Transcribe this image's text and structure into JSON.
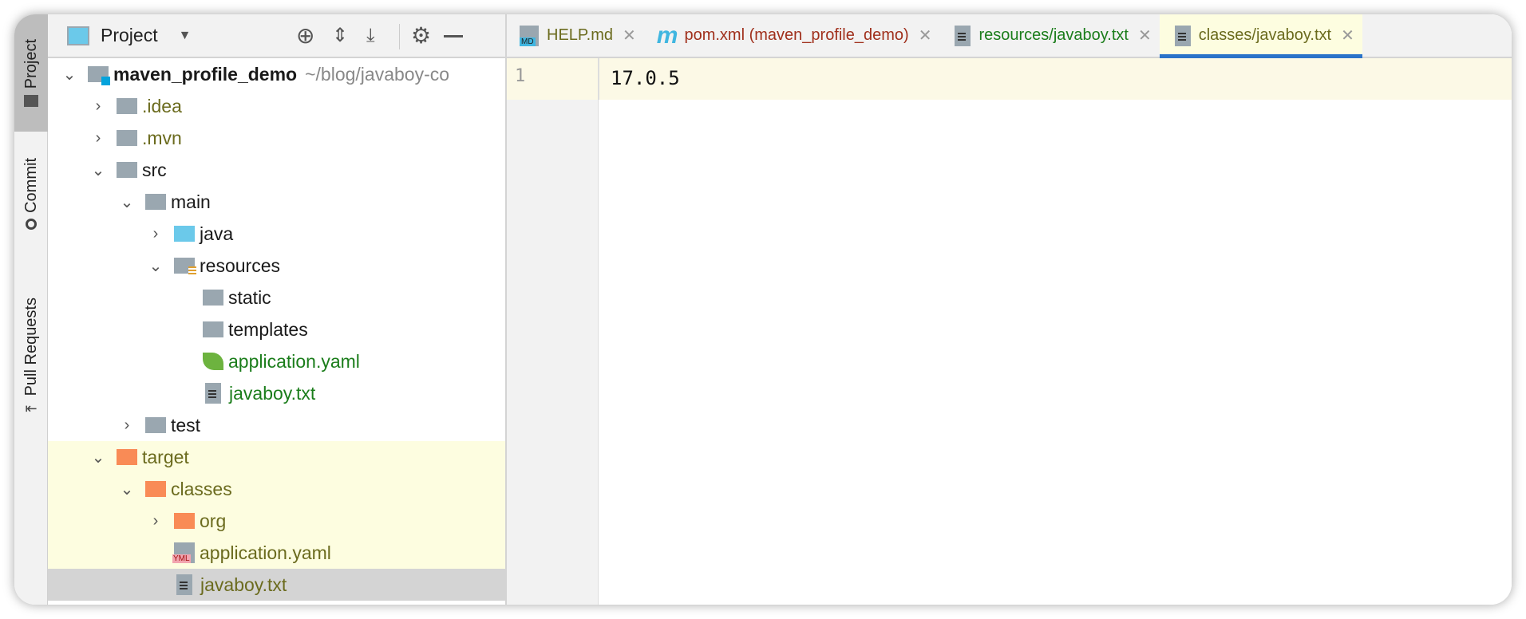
{
  "side_tabs": [
    "Project",
    "Commit",
    "Pull Requests"
  ],
  "panel": {
    "title": "Project"
  },
  "tree": [
    {
      "label": "maven_profile_demo",
      "suffix": "~/blog/javaboy-co",
      "level": 0,
      "chev": "v",
      "type": "module"
    },
    {
      "label": ".idea",
      "level": 1,
      "chev": ">",
      "type": "folder",
      "color": "#6b6b1e"
    },
    {
      "label": ".mvn",
      "level": 1,
      "chev": ">",
      "type": "folder",
      "color": "#6b6b1e"
    },
    {
      "label": "src",
      "level": 1,
      "chev": "v",
      "type": "folder"
    },
    {
      "label": "main",
      "level": 2,
      "chev": "v",
      "type": "folder"
    },
    {
      "label": "java",
      "level": 3,
      "chev": ">",
      "type": "folder-blue"
    },
    {
      "label": "resources",
      "level": 3,
      "chev": "v",
      "type": "folder-res"
    },
    {
      "label": "static",
      "level": 4,
      "type": "folder"
    },
    {
      "label": "templates",
      "level": 4,
      "type": "folder"
    },
    {
      "label": "application.yaml",
      "level": 4,
      "type": "spring",
      "color": "#1b7d1b"
    },
    {
      "label": "javaboy.txt",
      "level": 4,
      "type": "text",
      "color": "#1b7d1b"
    },
    {
      "label": "test",
      "level": 2,
      "chev": ">",
      "type": "folder"
    },
    {
      "label": "target",
      "level": 1,
      "chev": "v",
      "type": "folder-orange",
      "color": "#6b6b1e",
      "hl": true
    },
    {
      "label": "classes",
      "level": 2,
      "chev": "v",
      "type": "folder-orange",
      "color": "#6b6b1e",
      "hl": true
    },
    {
      "label": "org",
      "level": 3,
      "chev": ">",
      "type": "folder-orange",
      "color": "#6b6b1e",
      "hl": true
    },
    {
      "label": "application.yaml",
      "level": 3,
      "type": "yml",
      "color": "#6b6b1e",
      "hl": true
    },
    {
      "label": "javaboy.txt",
      "level": 3,
      "type": "text",
      "color": "#6b6b1e",
      "sel": true
    }
  ],
  "tabs": [
    {
      "label": "HELP.md",
      "color": "#6b6b1e",
      "icon": "markdown-icon"
    },
    {
      "label": "pom.xml (maven_profile_demo)",
      "color": "#a0301c",
      "icon": "maven-icon"
    },
    {
      "label": "resources/javaboy.txt",
      "color": "#1b7d1b",
      "icon": "text-file-icon"
    },
    {
      "label": "classes/javaboy.txt",
      "color": "#6b6b1e",
      "icon": "text-file-icon",
      "active": true
    }
  ],
  "editor": {
    "line_number": "1",
    "content": "17.0.5"
  },
  "icons": {
    "md": "MD",
    "yml": "YML",
    "maven": "m"
  }
}
